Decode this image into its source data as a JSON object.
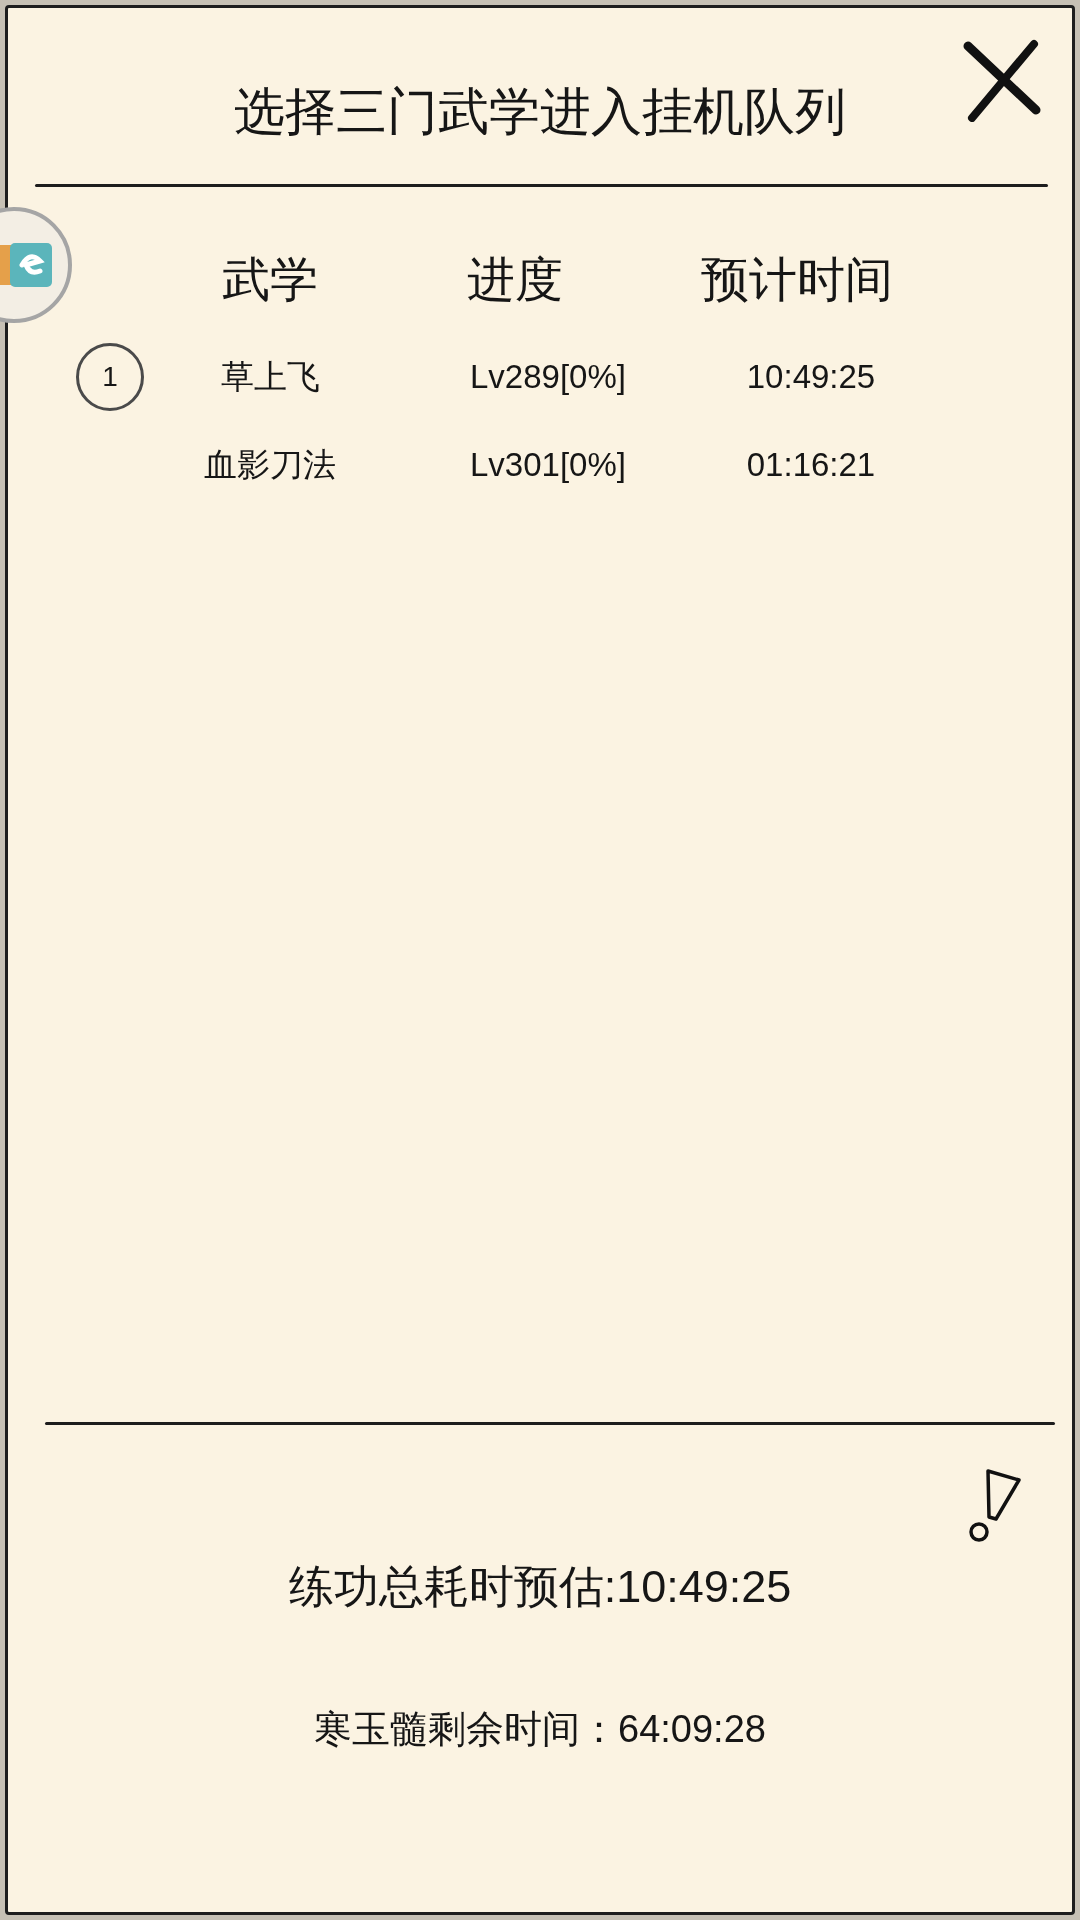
{
  "dialog": {
    "title": "选择三门武学进入挂机队列"
  },
  "table": {
    "columns": [
      "武学",
      "进度",
      "预计时间"
    ],
    "rows": [
      {
        "queue_number": "1",
        "skill": "草上飞",
        "progress": "Lv289[0%]",
        "estimated_time": "10:49:25"
      },
      {
        "skill": "血影刀法",
        "progress": "Lv301[0%]",
        "estimated_time": "01:16:21"
      }
    ]
  },
  "summary": {
    "total_time": "练功总耗时预估:10:49:25",
    "remaining_time": "寒玉髓剩余时间：64:09:28"
  }
}
